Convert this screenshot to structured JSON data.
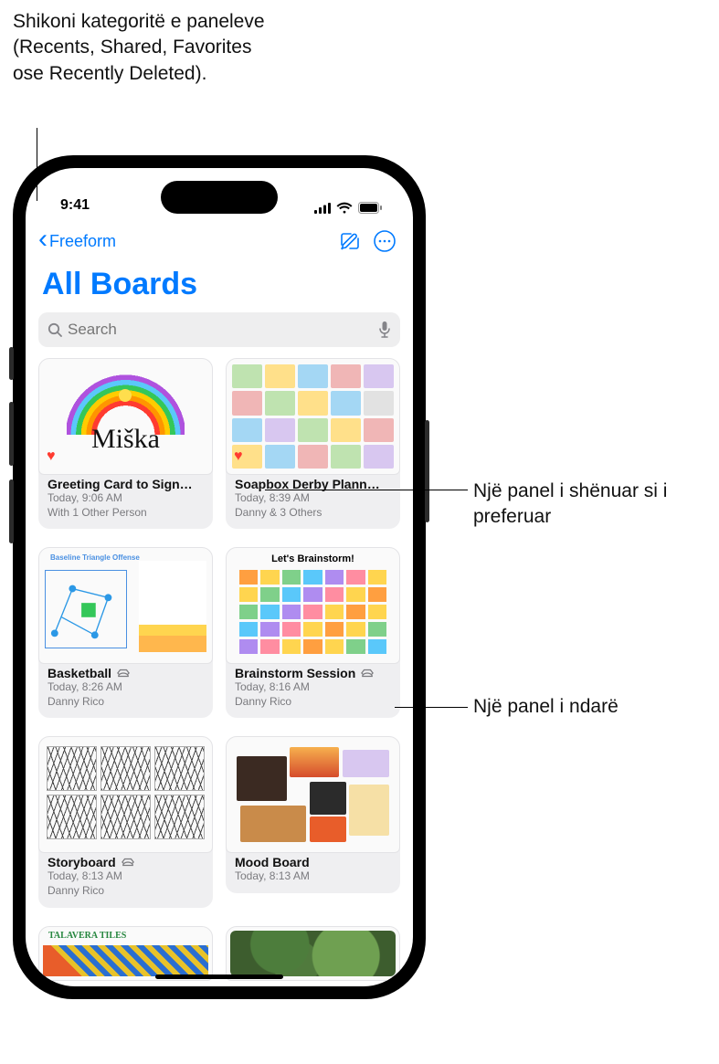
{
  "callouts": {
    "top": "Shikoni kategoritë e paneleve (Recents, Shared, Favorites ose Recently Deleted).",
    "fav": "Një panel i shënuar si i preferuar",
    "shared": "Një panel i ndarë"
  },
  "status": {
    "time": "9:41"
  },
  "nav": {
    "back_label": "Freeform",
    "title": "All Boards",
    "compose_icon": "compose-icon",
    "more_icon": "more-icon"
  },
  "search": {
    "placeholder": "Search"
  },
  "boards": [
    {
      "title": "Greeting Card to Sign…",
      "time": "Today, 9:06 AM",
      "people": "With 1 Other Person",
      "favorite": true,
      "shared": false,
      "art": "greeting"
    },
    {
      "title": "Soapbox Derby Plann…",
      "time": "Today, 8:39 AM",
      "people": "Danny & 3 Others",
      "favorite": true,
      "shared": false,
      "art": "soapbox"
    },
    {
      "title": "Basketball",
      "time": "Today, 8:26 AM",
      "people": "Danny Rico",
      "favorite": false,
      "shared": true,
      "art": "basketball"
    },
    {
      "title": "Brainstorm Session",
      "time": "Today, 8:16 AM",
      "people": "Danny Rico",
      "favorite": false,
      "shared": true,
      "art": "brainstorm"
    },
    {
      "title": "Storyboard",
      "time": "Today, 8:13 AM",
      "people": "Danny Rico",
      "favorite": false,
      "shared": true,
      "art": "storyboard"
    },
    {
      "title": "Mood Board",
      "time": "Today, 8:13 AM",
      "people": "",
      "favorite": false,
      "shared": false,
      "art": "mood"
    },
    {
      "title": "",
      "time": "",
      "people": "",
      "favorite": false,
      "shared": false,
      "art": "row4a"
    },
    {
      "title": "",
      "time": "",
      "people": "",
      "favorite": false,
      "shared": false,
      "art": "row4b"
    }
  ],
  "art_labels": {
    "miska": "Miška",
    "brainstorm": "Let's Brainstorm!",
    "talavera": "TALAVERA TILES"
  },
  "colors": {
    "accent": "#007aff",
    "heart": "#ff3b30"
  }
}
